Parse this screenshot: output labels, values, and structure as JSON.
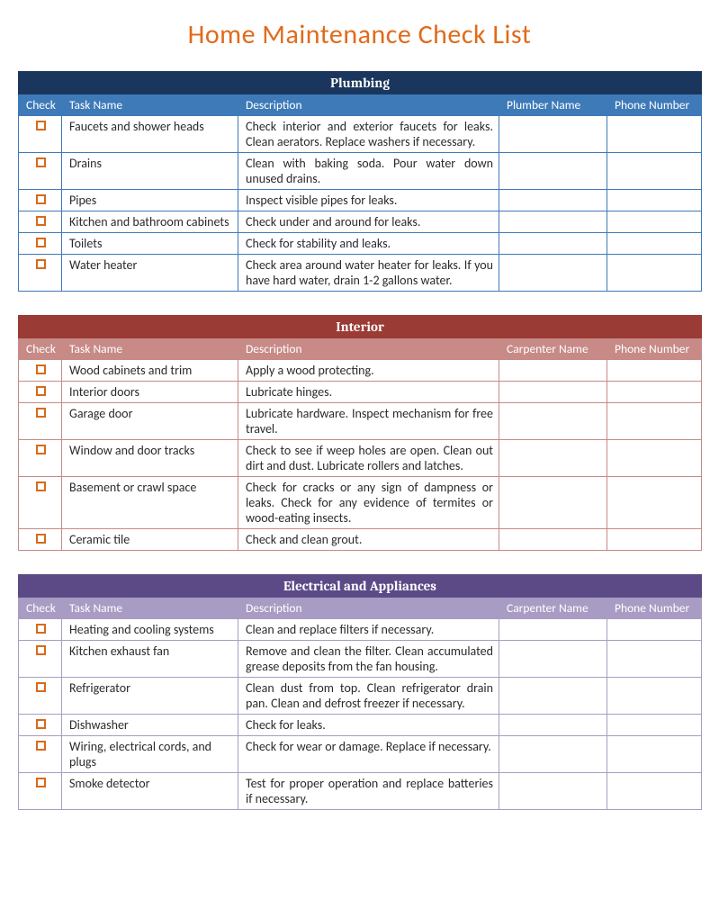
{
  "title": "Home Maintenance Check List",
  "columns": {
    "check": "Check",
    "task": "Task Name",
    "desc": "Description",
    "plumber": "Plumber Name",
    "carpenter": "Carpenter Name",
    "phone": "Phone Number"
  },
  "sections": [
    {
      "id": "plumbing",
      "theme": "plumbing",
      "title": "Plumbing",
      "worker_header_key": "plumber",
      "rows": [
        {
          "task": "Faucets and shower heads",
          "desc": "Check interior and exterior faucets for leaks. Clean aerators. Replace washers if necessary.",
          "worker": "",
          "phone": ""
        },
        {
          "task": "Drains",
          "desc": "Clean with baking soda. Pour water down unused drains.",
          "worker": "",
          "phone": ""
        },
        {
          "task": "Pipes",
          "desc": "Inspect visible pipes for leaks.",
          "worker": "",
          "phone": ""
        },
        {
          "task": "Kitchen and bathroom cabinets",
          "desc": "Check under and around for leaks.",
          "worker": "",
          "phone": ""
        },
        {
          "task": "Toilets",
          "desc": "Check for stability and leaks.",
          "worker": "",
          "phone": ""
        },
        {
          "task": "Water heater",
          "desc": "Check area around water heater for leaks. If you have hard water, drain 1-2 gallons water.",
          "worker": "",
          "phone": ""
        }
      ]
    },
    {
      "id": "interior",
      "theme": "interior",
      "title": "Interior",
      "worker_header_key": "carpenter",
      "rows": [
        {
          "task": "Wood cabinets and trim",
          "desc": "Apply a wood protecting.",
          "worker": "",
          "phone": ""
        },
        {
          "task": "Interior doors",
          "desc": "Lubricate hinges.",
          "worker": "",
          "phone": ""
        },
        {
          "task": "Garage door",
          "desc": "Lubricate hardware. Inspect mechanism for free travel.",
          "worker": "",
          "phone": ""
        },
        {
          "task": "Window and door tracks",
          "desc": "Check to see if weep holes are open. Clean out dirt and dust. Lubricate rollers and latches.",
          "worker": "",
          "phone": ""
        },
        {
          "task": "Basement or crawl space",
          "desc": "Check for cracks or any sign of dampness or leaks. Check for any evidence of termites or wood-eating insects.",
          "worker": "",
          "phone": ""
        },
        {
          "task": "Ceramic tile",
          "desc": "Check and clean grout.",
          "worker": "",
          "phone": ""
        }
      ]
    },
    {
      "id": "electrical",
      "theme": "electrical",
      "title": "Electrical and Appliances",
      "worker_header_key": "carpenter",
      "rows": [
        {
          "task": "Heating and cooling systems",
          "desc": "Clean and replace filters if necessary.",
          "worker": "",
          "phone": ""
        },
        {
          "task": "Kitchen exhaust fan",
          "desc": "Remove and clean the filter. Clean accumulated grease deposits from the fan housing.",
          "worker": "",
          "phone": ""
        },
        {
          "task": "Refrigerator",
          "desc": "Clean dust from top. Clean refrigerator drain pan. Clean and defrost freezer if necessary.",
          "worker": "",
          "phone": ""
        },
        {
          "task": "Dishwasher",
          "desc": "Check for leaks.",
          "worker": "",
          "phone": ""
        },
        {
          "task": "Wiring, electrical cords, and plugs",
          "desc": "Check for wear or damage. Replace if necessary.",
          "worker": "",
          "phone": ""
        },
        {
          "task": "Smoke detector",
          "desc": "Test for proper operation and replace batteries if necessary.",
          "worker": "",
          "phone": ""
        }
      ]
    }
  ]
}
